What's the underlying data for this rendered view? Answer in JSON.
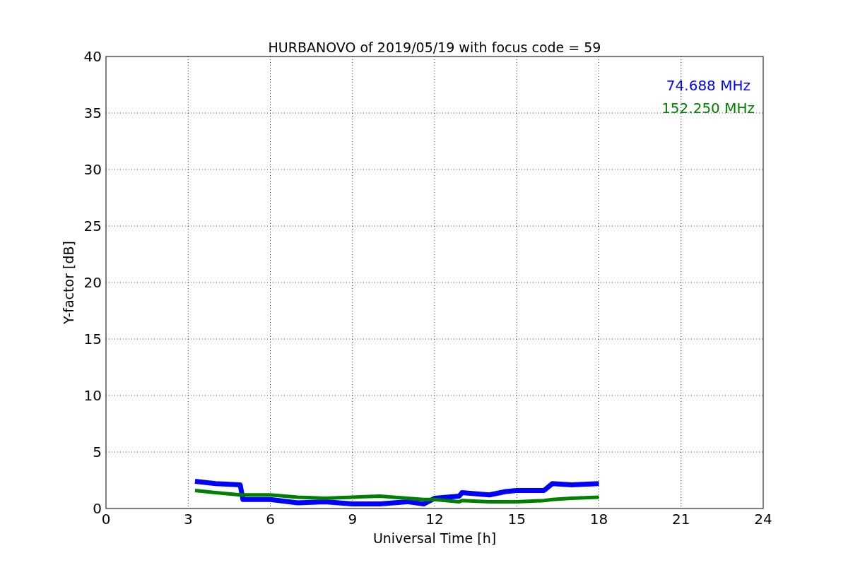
{
  "chart_data": {
    "type": "line",
    "title": "HURBANOVO of 2019/05/19 with focus code = 59",
    "xlabel": "Universal Time [h]",
    "ylabel": "Y-factor [dB]",
    "x": [
      3.25,
      4,
      4.9,
      5,
      6,
      7,
      8,
      9,
      10,
      11,
      11.6,
      12,
      12.9,
      13,
      14,
      14.6,
      15,
      16,
      16.3,
      17,
      18
    ],
    "series": [
      {
        "name": "74.688 MHz",
        "color": "#0000ff",
        "values": [
          2.4,
          2.2,
          2.1,
          0.8,
          0.8,
          0.5,
          0.6,
          0.4,
          0.4,
          0.6,
          0.4,
          0.9,
          1.1,
          1.4,
          1.2,
          1.5,
          1.6,
          1.6,
          2.2,
          2.1,
          2.2
        ]
      },
      {
        "name": "152.250 MHz",
        "color": "#008000",
        "values": [
          1.6,
          1.4,
          1.2,
          1.2,
          1.2,
          1.0,
          0.9,
          1.0,
          1.1,
          0.9,
          0.8,
          0.8,
          0.6,
          0.7,
          0.6,
          0.6,
          0.6,
          0.7,
          0.8,
          0.9,
          1.0
        ]
      }
    ],
    "xlim": [
      0,
      24
    ],
    "ylim": [
      0,
      40
    ],
    "xticks": [
      0,
      3,
      6,
      9,
      12,
      15,
      18,
      21,
      24
    ],
    "yticks": [
      0,
      5,
      10,
      15,
      20,
      25,
      30,
      35,
      40
    ],
    "grid": true
  }
}
